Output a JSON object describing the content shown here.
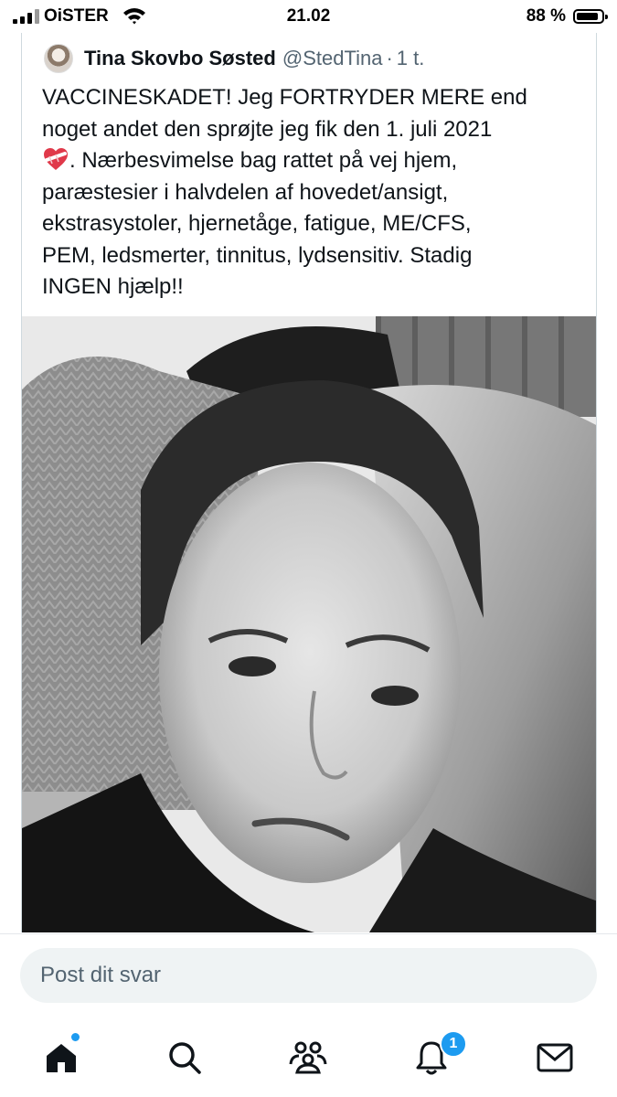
{
  "status_bar": {
    "carrier": "OiSTER",
    "time": "21.02",
    "battery_percent": "88 %",
    "battery_level": 0.88
  },
  "quoted_post": {
    "author_name": "Tina Skovbo Søsted",
    "author_handle": "@StedTina",
    "separator": "·",
    "time_ago": "1 t.",
    "text_lines": [
      "VACCINESKADET! Jeg FORTRYDER MERE end",
      "noget andet den sprøjte jeg fik den 1. juli 2021",
      ". Nærbesvimelse bag rattet på vej hjem,",
      "paræstesier i halvdelen af hovedet/ansigt,",
      "ekstrasystoler, hjernetåge, fatigue, ME/CFS,",
      "PEM, ledsmerter, tinnitus, lydsensitiv. Stadig",
      "INGEN hjælp!!"
    ],
    "inline_emoji": "mending-heart-icon",
    "photo_icon": "photo-image"
  },
  "reply": {
    "placeholder": "Post dit svar"
  },
  "bottom_nav": {
    "items": [
      "home-icon",
      "search-icon",
      "communities-icon",
      "notifications-icon",
      "messages-icon"
    ],
    "notifications_badge": "1"
  },
  "colors": {
    "accent": "#1d9bf0",
    "text": "#0f1419",
    "secondary_text": "#536471",
    "reply_bg": "#eff3f4"
  }
}
